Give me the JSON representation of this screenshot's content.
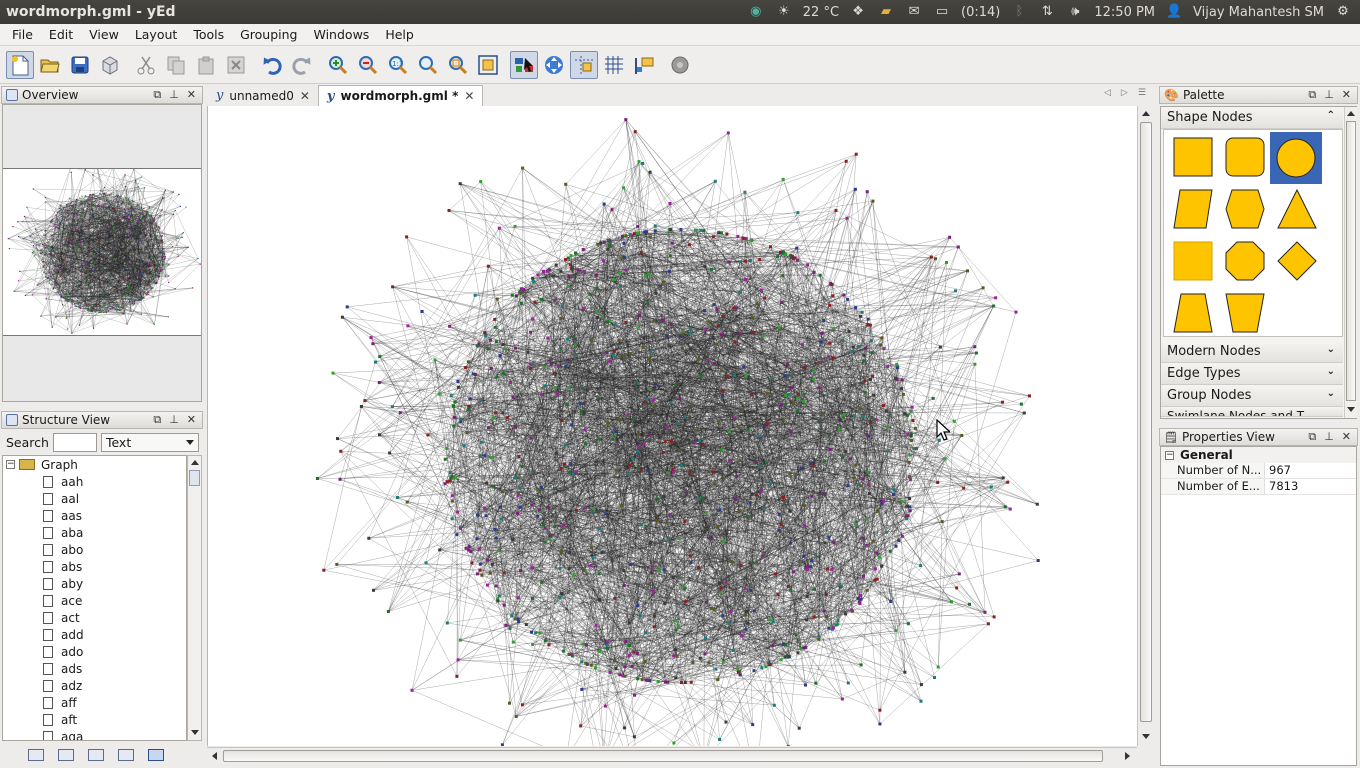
{
  "window": {
    "title": "wordmorph.gml - yEd"
  },
  "top_panel": {
    "weather": "22 °C",
    "battery": "(0:14)",
    "clock": "12:50 PM",
    "user": "Vijay Mahantesh SM",
    "icons": [
      "app-indicator-icon",
      "weather-sun-icon",
      "dropbox-icon",
      "clipboard-icon",
      "mail-icon",
      "battery-icon",
      "bluetooth-icon",
      "network-icon",
      "volume-icon",
      "user-icon",
      "gear-icon"
    ]
  },
  "menu": {
    "items": [
      {
        "label": "File"
      },
      {
        "label": "Edit"
      },
      {
        "label": "View"
      },
      {
        "label": "Layout"
      },
      {
        "label": "Tools"
      },
      {
        "label": "Grouping"
      },
      {
        "label": "Windows"
      },
      {
        "label": "Help"
      }
    ]
  },
  "toolbar": {
    "buttons": [
      "new-document-icon",
      "open-icon",
      "save-icon",
      "export-icon",
      "cut-icon",
      "copy-icon",
      "paste-icon",
      "delete-icon",
      "undo-icon",
      "redo-icon",
      "zoom-in-icon",
      "zoom-out-icon",
      "zoom-reset-icon",
      "zoom-area-icon",
      "fit-content-icon",
      "fit-page-icon",
      "select-mode-icon",
      "move-viewport-icon",
      "snap-lines-icon",
      "grid-icon",
      "port-constraints-icon",
      "plugin-icon"
    ]
  },
  "overview": {
    "title": "Overview"
  },
  "structure": {
    "title": "Structure View",
    "search_label": "Search",
    "search_value": "",
    "filter_value": "Text",
    "root": "Graph",
    "nodes": [
      "aah",
      "aal",
      "aas",
      "aba",
      "abo",
      "abs",
      "aby",
      "ace",
      "act",
      "add",
      "ado",
      "ads",
      "adz",
      "aff",
      "aft",
      "aga"
    ]
  },
  "tabs": [
    {
      "label": "unnamed0",
      "active": false
    },
    {
      "label": "wordmorph.gml *",
      "active": true
    }
  ],
  "palette": {
    "title": "Palette",
    "sections": {
      "shape_nodes": "Shape Nodes",
      "modern_nodes": "Modern Nodes",
      "edge_types": "Edge Types",
      "group_nodes": "Group Nodes",
      "swimlane": "Swimlane Nodes and T..."
    },
    "shapes": [
      "rectangle",
      "round-rectangle",
      "ellipse",
      "parallelogram",
      "hexagon-flat",
      "triangle",
      "rectangle-3d",
      "octagon",
      "diamond",
      "trapezoid",
      "trapezoid-inverted"
    ],
    "shape_color": "#ffc400",
    "selected_color": "#3a67b5"
  },
  "properties": {
    "title": "Properties View",
    "group": "General",
    "rows": [
      {
        "key": "Number of N...",
        "value": "967"
      },
      {
        "key": "Number of E...",
        "value": "7813"
      }
    ]
  },
  "graph": {
    "node_colors": [
      "#2b3a8c",
      "#7a1f7a",
      "#1f6f2f",
      "#8c1f1f",
      "#1f7a7a",
      "#5a5a1f",
      "#3a3a3a",
      "#a01fa0",
      "#2fa02f"
    ],
    "edge_color": "#222222"
  }
}
